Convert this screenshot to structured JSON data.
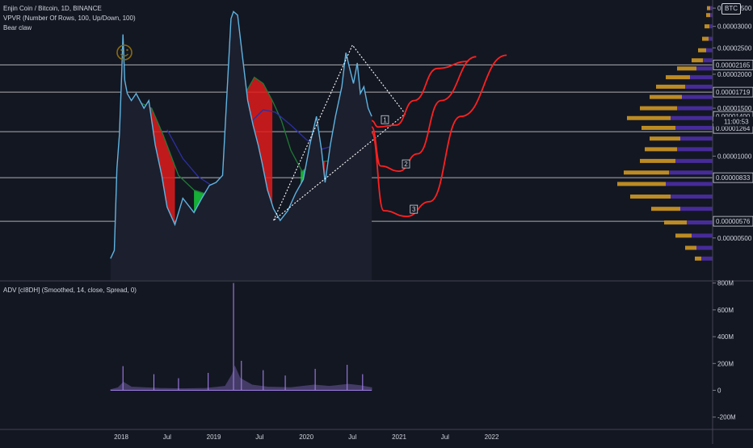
{
  "header": {
    "title": "Enjin Coin / Bitcoin, 1D, BINANCE",
    "indicator1": "VPVR (Number Of Rows, 100, Up/Down, 100)",
    "indicator2": "Bear claw",
    "badge": "BTC"
  },
  "countdown": "11:00:53",
  "colors": {
    "background": "#131722",
    "candle_up": "#26a69a",
    "price_line": "#5fb3e0",
    "bull_fill": "#16c93a",
    "bear_fill": "#e01b1b",
    "ma_green": "#1e7b34",
    "ma_blue": "#2d2fa3",
    "vp_up": "#4a2ca0",
    "vp_down": "#c59124",
    "projection": "#ff2020",
    "level_line": "#c8c8c8",
    "adv_line": "#a07ee8"
  },
  "chart_data": [
    {
      "type": "line",
      "title": "Enjin Coin / Bitcoin, 1D, BINANCE",
      "x_ticks": [
        "2018",
        "Jul",
        "2019",
        "Jul",
        "2020",
        "Jul",
        "2021",
        "Jul",
        "2022"
      ],
      "y_ticks": [
        "0.00000500",
        "0.00001000",
        "0.00001500",
        "0.00002000",
        "0.00002500",
        "0.00003000",
        "0.00003500"
      ],
      "y_scale": "log",
      "ylim": [
        3.5e-06,
        3.75e-05
      ],
      "price_labels": [
        {
          "value": "0.00002165",
          "v": 2.165e-05
        },
        {
          "value": "0.00001719",
          "v": 1.719e-05
        },
        {
          "value": "0.00001400",
          "v": 1.4e-05
        },
        {
          "value": "0.00001264",
          "v": 1.264e-05
        },
        {
          "value": "0.00000833",
          "v": 8.33e-06
        },
        {
          "value": "0.00000576",
          "v": 5.76e-06
        }
      ],
      "horizontal_levels": [
        2.165e-05,
        1.719e-05,
        1.23e-05,
        8.33e-06,
        5.76e-06
      ],
      "series": [
        {
          "points": [
            [
              "2017-11-20",
              4.2e-06
            ],
            [
              "2017-12-05",
              4.5e-06
            ],
            [
              "2017-12-15",
              9e-06
            ],
            [
              "2017-12-25",
              1.2e-05
            ],
            [
              "2018-01-03",
              2e-05
            ],
            [
              "2018-01-08",
              2.8e-05
            ],
            [
              "2018-01-15",
              1.9e-05
            ],
            [
              "2018-01-25",
              1.7e-05
            ],
            [
              "2018-02-10",
              1.6e-05
            ],
            [
              "2018-03-01",
              1.7e-05
            ],
            [
              "2018-04-01",
              1.5e-05
            ],
            [
              "2018-04-20",
              1.6e-05
            ],
            [
              "2018-05-15",
              1.1e-05
            ],
            [
              "2018-06-10",
              8.5e-06
            ],
            [
              "2018-07-01",
              6.5e-06
            ],
            [
              "2018-08-01",
              5.6e-06
            ],
            [
              "2018-09-01",
              7e-06
            ],
            [
              "2018-10-15",
              6.2e-06
            ],
            [
              "2018-11-15",
              7e-06
            ],
            [
              "2018-12-15",
              7.8e-06
            ],
            [
              "2019-01-10",
              8e-06
            ],
            [
              "2019-02-05",
              8.5e-06
            ],
            [
              "2019-02-25",
              1.9e-05
            ],
            [
              "2019-03-10",
              3.2e-05
            ],
            [
              "2019-03-20",
              3.4e-05
            ],
            [
              "2019-04-05",
              3.3e-05
            ],
            [
              "2019-04-25",
              2.3e-05
            ],
            [
              "2019-05-15",
              1.6e-05
            ],
            [
              "2019-06-05",
              1.3e-05
            ],
            [
              "2019-06-25",
              1.1e-05
            ],
            [
              "2019-07-10",
              9.5e-06
            ],
            [
              "2019-08-01",
              7.5e-06
            ],
            [
              "2019-08-25",
              6.4e-06
            ],
            [
              "2019-09-20",
              5.8e-06
            ],
            [
              "2019-10-20",
              6.3e-06
            ],
            [
              "2019-11-20",
              7.3e-06
            ],
            [
              "2019-12-20",
              8.2e-06
            ],
            [
              "2020-01-15",
              1.1e-05
            ],
            [
              "2020-02-10",
              1.4e-05
            ],
            [
              "2020-03-01",
              1.05e-05
            ],
            [
              "2020-03-15",
              8e-06
            ],
            [
              "2020-04-05",
              1.1e-05
            ],
            [
              "2020-04-25",
              1.4e-05
            ],
            [
              "2020-05-20",
              1.8e-05
            ],
            [
              "2020-06-05",
              2.4e-05
            ],
            [
              "2020-06-20",
              2.1e-05
            ],
            [
              "2020-07-05",
              1.85e-05
            ],
            [
              "2020-07-20",
              2.2e-05
            ],
            [
              "2020-08-01",
              1.7e-05
            ],
            [
              "2020-08-15",
              1.8e-05
            ],
            [
              "2020-09-01",
              1.5e-05
            ],
            [
              "2020-09-15",
              1.4e-05
            ]
          ]
        },
        {
          "points": [
            [
              "2018-01-20",
              1.3e-05
            ],
            [
              "2018-03-01",
              1.6e-05
            ],
            [
              "2018-05-01",
              1.5e-05
            ],
            [
              "2018-06-15",
              1.2e-05
            ],
            [
              "2018-08-15",
              8.5e-06
            ],
            [
              "2018-10-15",
              7.5e-06
            ],
            [
              "2018-12-15",
              7.2e-06
            ],
            [
              "2019-02-15",
              7.6e-06
            ],
            [
              "2019-03-25",
              1.1e-05
            ],
            [
              "2019-05-05",
              1.7e-05
            ],
            [
              "2019-06-10",
              1.95e-05
            ],
            [
              "2019-07-15",
              1.85e-05
            ],
            [
              "2019-08-20",
              1.6e-05
            ],
            [
              "2019-09-25",
              1.35e-05
            ],
            [
              "2019-11-01",
              1.05e-05
            ],
            [
              "2019-12-15",
              8.8e-06
            ],
            [
              "2020-02-01",
              9.5e-06
            ],
            [
              "2020-04-01",
              9.6e-06
            ],
            [
              "2020-05-15",
              1.15e-05
            ],
            [
              "2020-07-01",
              1.45e-05
            ],
            [
              "2020-08-15",
              1.55e-05
            ],
            [
              "2020-09-15",
              1.35e-05
            ]
          ]
        },
        {
          "points": [
            [
              "2018-07-01",
              1.25e-05
            ],
            [
              "2018-09-01",
              9.8e-06
            ],
            [
              "2018-11-01",
              8.4e-06
            ],
            [
              "2019-01-01",
              7.7e-06
            ],
            [
              "2019-03-01",
              8.6e-06
            ],
            [
              "2019-04-15",
              1.1e-05
            ],
            [
              "2019-06-01",
              1.35e-05
            ],
            [
              "2019-07-15",
              1.48e-05
            ],
            [
              "2019-09-01",
              1.45e-05
            ],
            [
              "2019-11-01",
              1.3e-05
            ],
            [
              "2020-01-01",
              1.15e-05
            ],
            [
              "2020-03-01",
              1.06e-05
            ],
            [
              "2020-05-01",
              1.1e-05
            ],
            [
              "2020-07-01",
              1.18e-05
            ],
            [
              "2020-09-15",
              1.22e-05
            ]
          ]
        }
      ],
      "bull_zones": [
        {
          "from": "2018-10-15",
          "to": "2018-12-20"
        },
        {
          "from": "2019-02-20",
          "to": "2019-04-05"
        },
        {
          "from": "2019-12-10",
          "to": "2020-02-10"
        },
        {
          "from": "2020-04-10",
          "to": "2020-08-10"
        }
      ],
      "bear_zones": [
        {
          "from": "2018-04-10",
          "to": "2018-08-01"
        },
        {
          "from": "2019-04-10",
          "to": "2019-08-20"
        },
        {
          "from": "2020-02-12",
          "to": "2020-03-15"
        },
        {
          "from": "2020-08-15",
          "to": "2020-09-15"
        }
      ],
      "triangle": [
        [
          "2019-08-25",
          5.8e-06
        ],
        [
          "2020-07-01",
          2.56e-05
        ],
        [
          "2021-01-25",
          1.43e-05
        ]
      ],
      "projections": [
        {
          "label": "1",
          "points": [
            [
              "2020-09-15",
              1.35e-05
            ],
            [
              "2020-10-10",
              1.28e-05
            ],
            [
              "2020-12-20",
              1.3e-05
            ],
            [
              "2021-03-01",
              1.6e-05
            ],
            [
              "2021-06-01",
              2.1e-05
            ],
            [
              "2021-10-01",
              2.23e-05
            ]
          ]
        },
        {
          "label": "2",
          "points": [
            [
              "2020-09-15",
              1.28e-05
            ],
            [
              "2020-10-20",
              9.2e-06
            ],
            [
              "2021-01-01",
              8.8e-06
            ],
            [
              "2021-03-15",
              1.02e-05
            ],
            [
              "2021-06-15",
              1.6e-05
            ],
            [
              "2021-11-01",
              2.32e-05
            ]
          ]
        },
        {
          "label": "3",
          "points": [
            [
              "2020-09-15",
              1.22e-05
            ],
            [
              "2020-11-01",
              6.3e-06
            ],
            [
              "2021-02-01",
              6e-06
            ],
            [
              "2021-05-01",
              6.8e-06
            ],
            [
              "2021-09-01",
              1.4e-05
            ],
            [
              "2022-03-01",
              2.35e-05
            ]
          ]
        }
      ],
      "volume_profile": [
        {
          "price": 3.5e-05,
          "up": 3,
          "down": 4
        },
        {
          "price": 3.3e-05,
          "up": 3,
          "down": 5
        },
        {
          "price": 3e-05,
          "up": 4,
          "down": 6
        },
        {
          "price": 2.7e-05,
          "up": 5,
          "down": 8
        },
        {
          "price": 2.45e-05,
          "up": 8,
          "down": 10
        },
        {
          "price": 2.25e-05,
          "up": 12,
          "down": 14
        },
        {
          "price": 2.1e-05,
          "up": 20,
          "down": 24
        },
        {
          "price": 1.95e-05,
          "up": 28,
          "down": 30
        },
        {
          "price": 1.8e-05,
          "up": 34,
          "down": 36
        },
        {
          "price": 1.65e-05,
          "up": 38,
          "down": 40
        },
        {
          "price": 1.5e-05,
          "up": 44,
          "down": 46
        },
        {
          "price": 1.38e-05,
          "up": 52,
          "down": 54
        },
        {
          "price": 1.27e-05,
          "up": 46,
          "down": 42
        },
        {
          "price": 1.16e-05,
          "up": 40,
          "down": 38
        },
        {
          "price": 1.06e-05,
          "up": 44,
          "down": 40
        },
        {
          "price": 9.6e-06,
          "up": 46,
          "down": 44
        },
        {
          "price": 8.7e-06,
          "up": 54,
          "down": 56
        },
        {
          "price": 7.9e-06,
          "up": 58,
          "down": 60
        },
        {
          "price": 7.1e-06,
          "up": 52,
          "down": 50
        },
        {
          "price": 6.4e-06,
          "up": 40,
          "down": 36
        },
        {
          "price": 5.7e-06,
          "up": 32,
          "down": 28
        },
        {
          "price": 5.1e-06,
          "up": 26,
          "down": 20
        },
        {
          "price": 4.6e-06,
          "up": 20,
          "down": 14
        },
        {
          "price": 4.2e-06,
          "up": 14,
          "down": 8
        }
      ]
    },
    {
      "type": "area",
      "title": "ADV [cI8DH] (Smoothed, 14, close, Spread, 0)",
      "y_ticks": [
        "800M",
        "600M",
        "400M",
        "200M",
        "0",
        "-200M"
      ],
      "ylim": [
        -280,
        810
      ],
      "series": [
        {
          "points": [
            [
              "2017-11-20",
              5
            ],
            [
              "2017-12-20",
              20
            ],
            [
              "2018-01-10",
              60
            ],
            [
              "2018-02-10",
              25
            ],
            [
              "2018-04-01",
              20
            ],
            [
              "2018-06-01",
              15
            ],
            [
              "2018-09-01",
              12
            ],
            [
              "2018-12-01",
              15
            ],
            [
              "2019-02-15",
              30
            ],
            [
              "2019-03-15",
              120
            ],
            [
              "2019-03-25",
              180
            ],
            [
              "2019-04-15",
              90
            ],
            [
              "2019-06-01",
              40
            ],
            [
              "2019-08-01",
              25
            ],
            [
              "2019-11-01",
              20
            ],
            [
              "2020-02-01",
              40
            ],
            [
              "2020-04-01",
              30
            ],
            [
              "2020-06-15",
              45
            ],
            [
              "2020-08-01",
              35
            ],
            [
              "2020-09-15",
              20
            ]
          ]
        }
      ],
      "spikes": [
        [
          "2018-01-08",
          180
        ],
        [
          "2018-05-10",
          120
        ],
        [
          "2018-08-15",
          90
        ],
        [
          "2018-12-10",
          130
        ],
        [
          "2019-03-20",
          800
        ],
        [
          "2019-04-20",
          220
        ],
        [
          "2019-07-15",
          150
        ],
        [
          "2019-10-10",
          110
        ],
        [
          "2020-02-05",
          160
        ],
        [
          "2020-06-10",
          190
        ],
        [
          "2020-08-10",
          120
        ]
      ]
    }
  ]
}
